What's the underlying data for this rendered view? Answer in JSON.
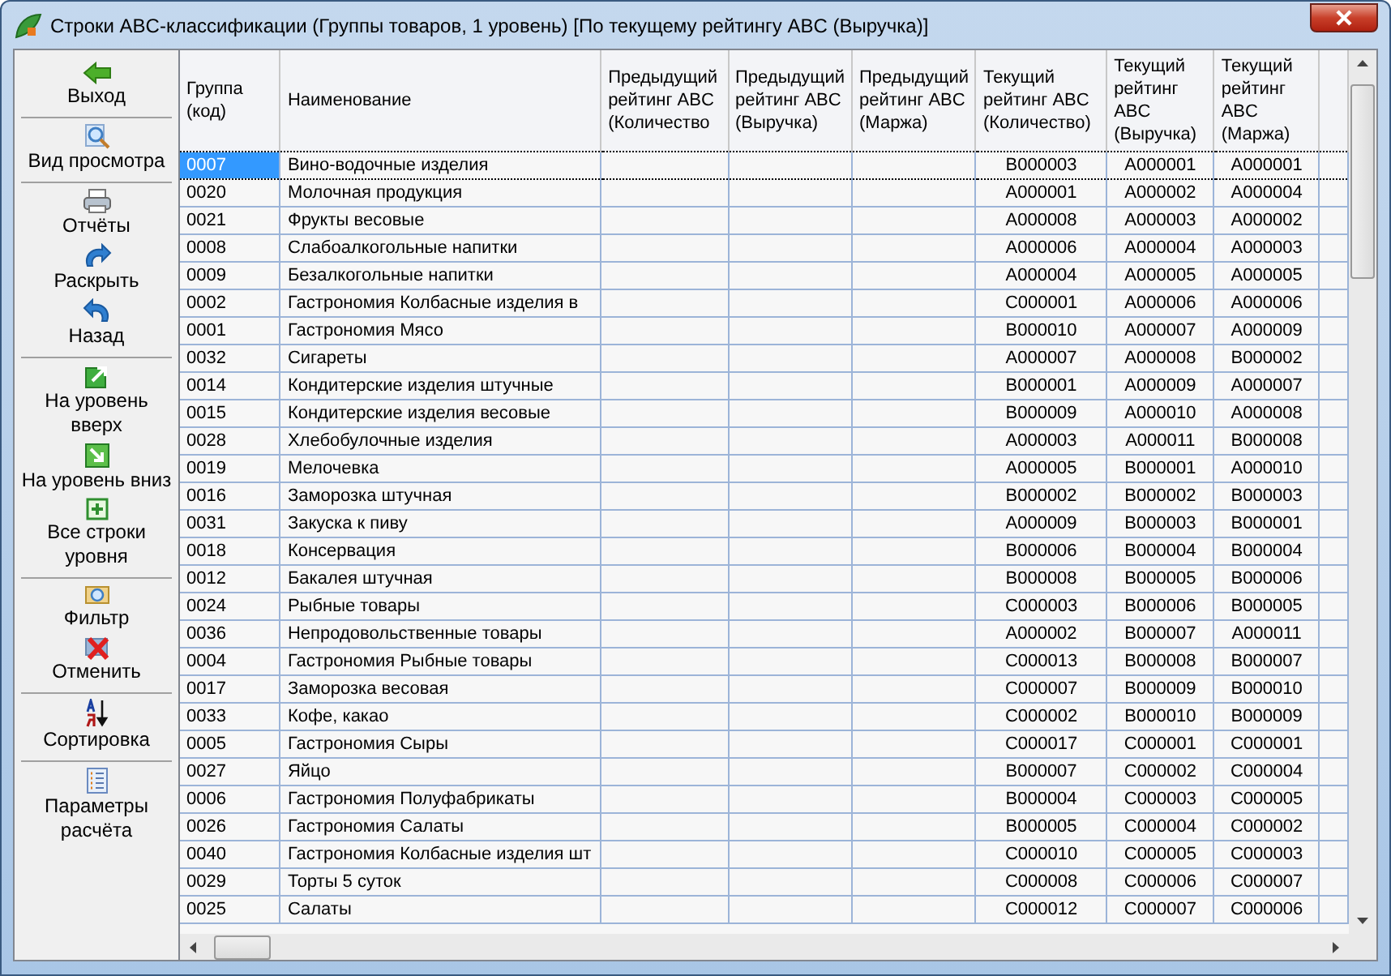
{
  "window": {
    "title": "Строки ABC-классификации (Группы товаров, 1 уровень) [По текущему рейтингу ABC (Выручка)]"
  },
  "sidebar": {
    "groups": [
      [
        "Выход"
      ],
      [
        "Вид просмотра"
      ],
      [
        "Отчёты",
        "Раскрыть",
        "Назад"
      ],
      [
        "На уровень вверх",
        "На уровень вниз",
        "Все строки уровня"
      ],
      [
        "Фильтр",
        "Отменить"
      ],
      [
        "Сортировка"
      ],
      [
        "Параметры расчёта"
      ]
    ]
  },
  "table": {
    "columns": [
      "Группа (код)",
      "Наименование",
      "Предыдущий рейтинг ABC (Количество",
      "Предыдущий рейтинг ABC (Выручка)",
      "Предыдущий рейтинг ABC (Маржа)",
      "Текущий рейтинг ABC (Количество)",
      "Текущий рейтинг ABC (Выручка)",
      "Текущий рейтинг ABC (Маржа)"
    ],
    "rows": [
      {
        "selected": true,
        "cells": [
          "0007",
          "Вино-водочные изделия",
          "",
          "",
          "",
          "B000003",
          "A000001",
          "A000001"
        ]
      },
      {
        "selected": false,
        "cells": [
          "0020",
          "Молочная продукция",
          "",
          "",
          "",
          "A000001",
          "A000002",
          "A000004"
        ]
      },
      {
        "selected": false,
        "cells": [
          "0021",
          "Фрукты весовые",
          "",
          "",
          "",
          "A000008",
          "A000003",
          "A000002"
        ]
      },
      {
        "selected": false,
        "cells": [
          "0008",
          "Слабоалкогольные напитки",
          "",
          "",
          "",
          "A000006",
          "A000004",
          "A000003"
        ]
      },
      {
        "selected": false,
        "cells": [
          "0009",
          "Безалкогольные напитки",
          "",
          "",
          "",
          "A000004",
          "A000005",
          "A000005"
        ]
      },
      {
        "selected": false,
        "cells": [
          "0002",
          "Гастрономия Колбасные изделия в",
          "",
          "",
          "",
          "C000001",
          "A000006",
          "A000006"
        ]
      },
      {
        "selected": false,
        "cells": [
          "0001",
          "Гастрономия Мясо",
          "",
          "",
          "",
          "B000010",
          "A000007",
          "A000009"
        ]
      },
      {
        "selected": false,
        "cells": [
          "0032",
          "Сигареты",
          "",
          "",
          "",
          "A000007",
          "A000008",
          "B000002"
        ]
      },
      {
        "selected": false,
        "cells": [
          "0014",
          "Кондитерские изделия штучные",
          "",
          "",
          "",
          "B000001",
          "A000009",
          "A000007"
        ]
      },
      {
        "selected": false,
        "cells": [
          "0015",
          "Кондитерские изделия весовые",
          "",
          "",
          "",
          "B000009",
          "A000010",
          "A000008"
        ]
      },
      {
        "selected": false,
        "cells": [
          "0028",
          "Хлебобулочные изделия",
          "",
          "",
          "",
          "A000003",
          "A000011",
          "B000008"
        ]
      },
      {
        "selected": false,
        "cells": [
          "0019",
          "Мелочевка",
          "",
          "",
          "",
          "A000005",
          "B000001",
          "A000010"
        ]
      },
      {
        "selected": false,
        "cells": [
          "0016",
          "Заморозка штучная",
          "",
          "",
          "",
          "B000002",
          "B000002",
          "B000003"
        ]
      },
      {
        "selected": false,
        "cells": [
          "0031",
          "Закуска к пиву",
          "",
          "",
          "",
          "A000009",
          "B000003",
          "B000001"
        ]
      },
      {
        "selected": false,
        "cells": [
          "0018",
          "Консервация",
          "",
          "",
          "",
          "B000006",
          "B000004",
          "B000004"
        ]
      },
      {
        "selected": false,
        "cells": [
          "0012",
          "Бакалея штучная",
          "",
          "",
          "",
          "B000008",
          "B000005",
          "B000006"
        ]
      },
      {
        "selected": false,
        "cells": [
          "0024",
          "Рыбные товары",
          "",
          "",
          "",
          "C000003",
          "B000006",
          "B000005"
        ]
      },
      {
        "selected": false,
        "cells": [
          "0036",
          "Непродовольственные товары",
          "",
          "",
          "",
          "A000002",
          "B000007",
          "A000011"
        ]
      },
      {
        "selected": false,
        "cells": [
          "0004",
          "Гастрономия Рыбные товары",
          "",
          "",
          "",
          "C000013",
          "B000008",
          "B000007"
        ]
      },
      {
        "selected": false,
        "cells": [
          "0017",
          "Заморозка весовая",
          "",
          "",
          "",
          "C000007",
          "B000009",
          "B000010"
        ]
      },
      {
        "selected": false,
        "cells": [
          "0033",
          "Кофе, какао",
          "",
          "",
          "",
          "C000002",
          "B000010",
          "B000009"
        ]
      },
      {
        "selected": false,
        "cells": [
          "0005",
          "Гастрономия Сыры",
          "",
          "",
          "",
          "C000017",
          "C000001",
          "C000001"
        ]
      },
      {
        "selected": false,
        "cells": [
          "0027",
          "Яйцо",
          "",
          "",
          "",
          "B000007",
          "C000002",
          "C000004"
        ]
      },
      {
        "selected": false,
        "cells": [
          "0006",
          "Гастрономия Полуфабрикаты",
          "",
          "",
          "",
          "B000004",
          "C000003",
          "C000005"
        ]
      },
      {
        "selected": false,
        "cells": [
          "0026",
          "Гастрономия Салаты",
          "",
          "",
          "",
          "B000005",
          "C000004",
          "C000002"
        ]
      },
      {
        "selected": false,
        "cells": [
          "0040",
          "Гастрономия Колбасные изделия шт",
          "",
          "",
          "",
          "C000010",
          "C000005",
          "C000003"
        ]
      },
      {
        "selected": false,
        "cells": [
          "0029",
          "Торты 5 суток",
          "",
          "",
          "",
          "C000008",
          "C000006",
          "C000007"
        ]
      },
      {
        "selected": false,
        "cells": [
          "0025",
          "Салаты",
          "",
          "",
          "",
          "C000012",
          "C000007",
          "C000006"
        ]
      }
    ]
  }
}
